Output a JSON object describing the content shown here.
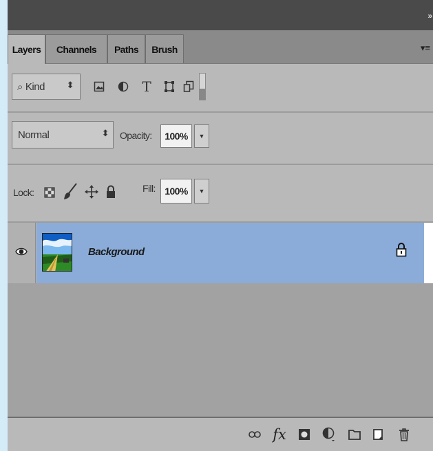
{
  "panel": {
    "tabs": [
      {
        "label": "Layers",
        "active": true
      },
      {
        "label": "Channels",
        "active": false
      },
      {
        "label": "Paths",
        "active": false
      },
      {
        "label": "Brush",
        "active": false
      }
    ],
    "collapse_glyph": "»",
    "menu_glyph": "▾≡"
  },
  "filter": {
    "kind_search_glyph": "⌕",
    "kind_label": "Kind",
    "icons": [
      "image-filter-icon",
      "adjustment-filter-icon",
      "type-filter-icon",
      "shape-filter-icon",
      "smart-object-filter-icon"
    ],
    "type_glyph": "T"
  },
  "blend": {
    "mode": "Normal",
    "opacity_label": "Opacity:",
    "opacity_value": "100%",
    "dropdown_glyph": "▼"
  },
  "lock": {
    "label": "Lock:",
    "icons": [
      "lock-transparent-icon",
      "lock-image-icon",
      "lock-position-icon",
      "lock-all-icon"
    ],
    "fill_label": "Fill:",
    "fill_value": "100%",
    "dropdown_glyph": "▼"
  },
  "layers": [
    {
      "name": "Background",
      "visible": true,
      "locked": true,
      "selected": true
    }
  ],
  "colors": {
    "selection": "#8bacd9",
    "panel_bg": "#b9b9b9",
    "empty_bg": "#a2a2a2",
    "outer_bg": "#d4ecf8"
  },
  "bottom_toolbar": {
    "icons": [
      "link-layers-icon",
      "layer-style-icon",
      "add-mask-icon",
      "adjustment-layer-icon",
      "new-group-icon",
      "new-layer-icon",
      "delete-layer-icon"
    ],
    "fx_glyph": "fx"
  }
}
